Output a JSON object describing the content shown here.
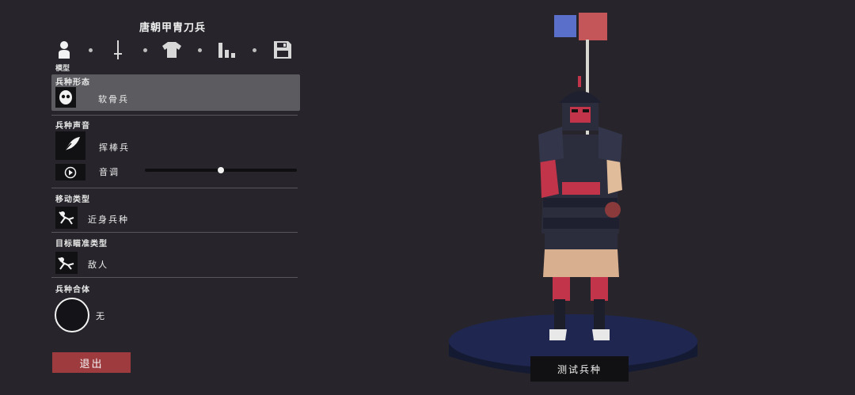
{
  "header": {
    "title": "唐朝甲胄刀兵",
    "active_tab_label": "模型"
  },
  "tabs": [
    {
      "name": "model",
      "icon": "person-icon"
    },
    {
      "name": "weapon",
      "icon": "sword-icon"
    },
    {
      "name": "clothing",
      "icon": "shirt-icon"
    },
    {
      "name": "stats",
      "icon": "bar-chart-icon"
    },
    {
      "name": "save",
      "icon": "save-icon"
    }
  ],
  "sections": {
    "form": {
      "label": "兵种形态",
      "value": "软骨兵"
    },
    "voice": {
      "label": "兵种声音",
      "value": "挥棒兵",
      "pitch_label": "音调",
      "pitch_level": 0.5
    },
    "movement": {
      "label": "移动类型",
      "value": "近身兵种"
    },
    "targeting": {
      "label": "目标瞄准类型",
      "value": "敌人"
    },
    "merge": {
      "label": "兵种合体",
      "value": "无"
    }
  },
  "buttons": {
    "exit": "退出",
    "test": "测试兵种"
  },
  "colors": {
    "team_blue": "#5a6fc9",
    "team_red": "#c45558",
    "exit_button": "#9d3b3e",
    "selected_row": "#5c5b60",
    "background": "#27252b"
  }
}
